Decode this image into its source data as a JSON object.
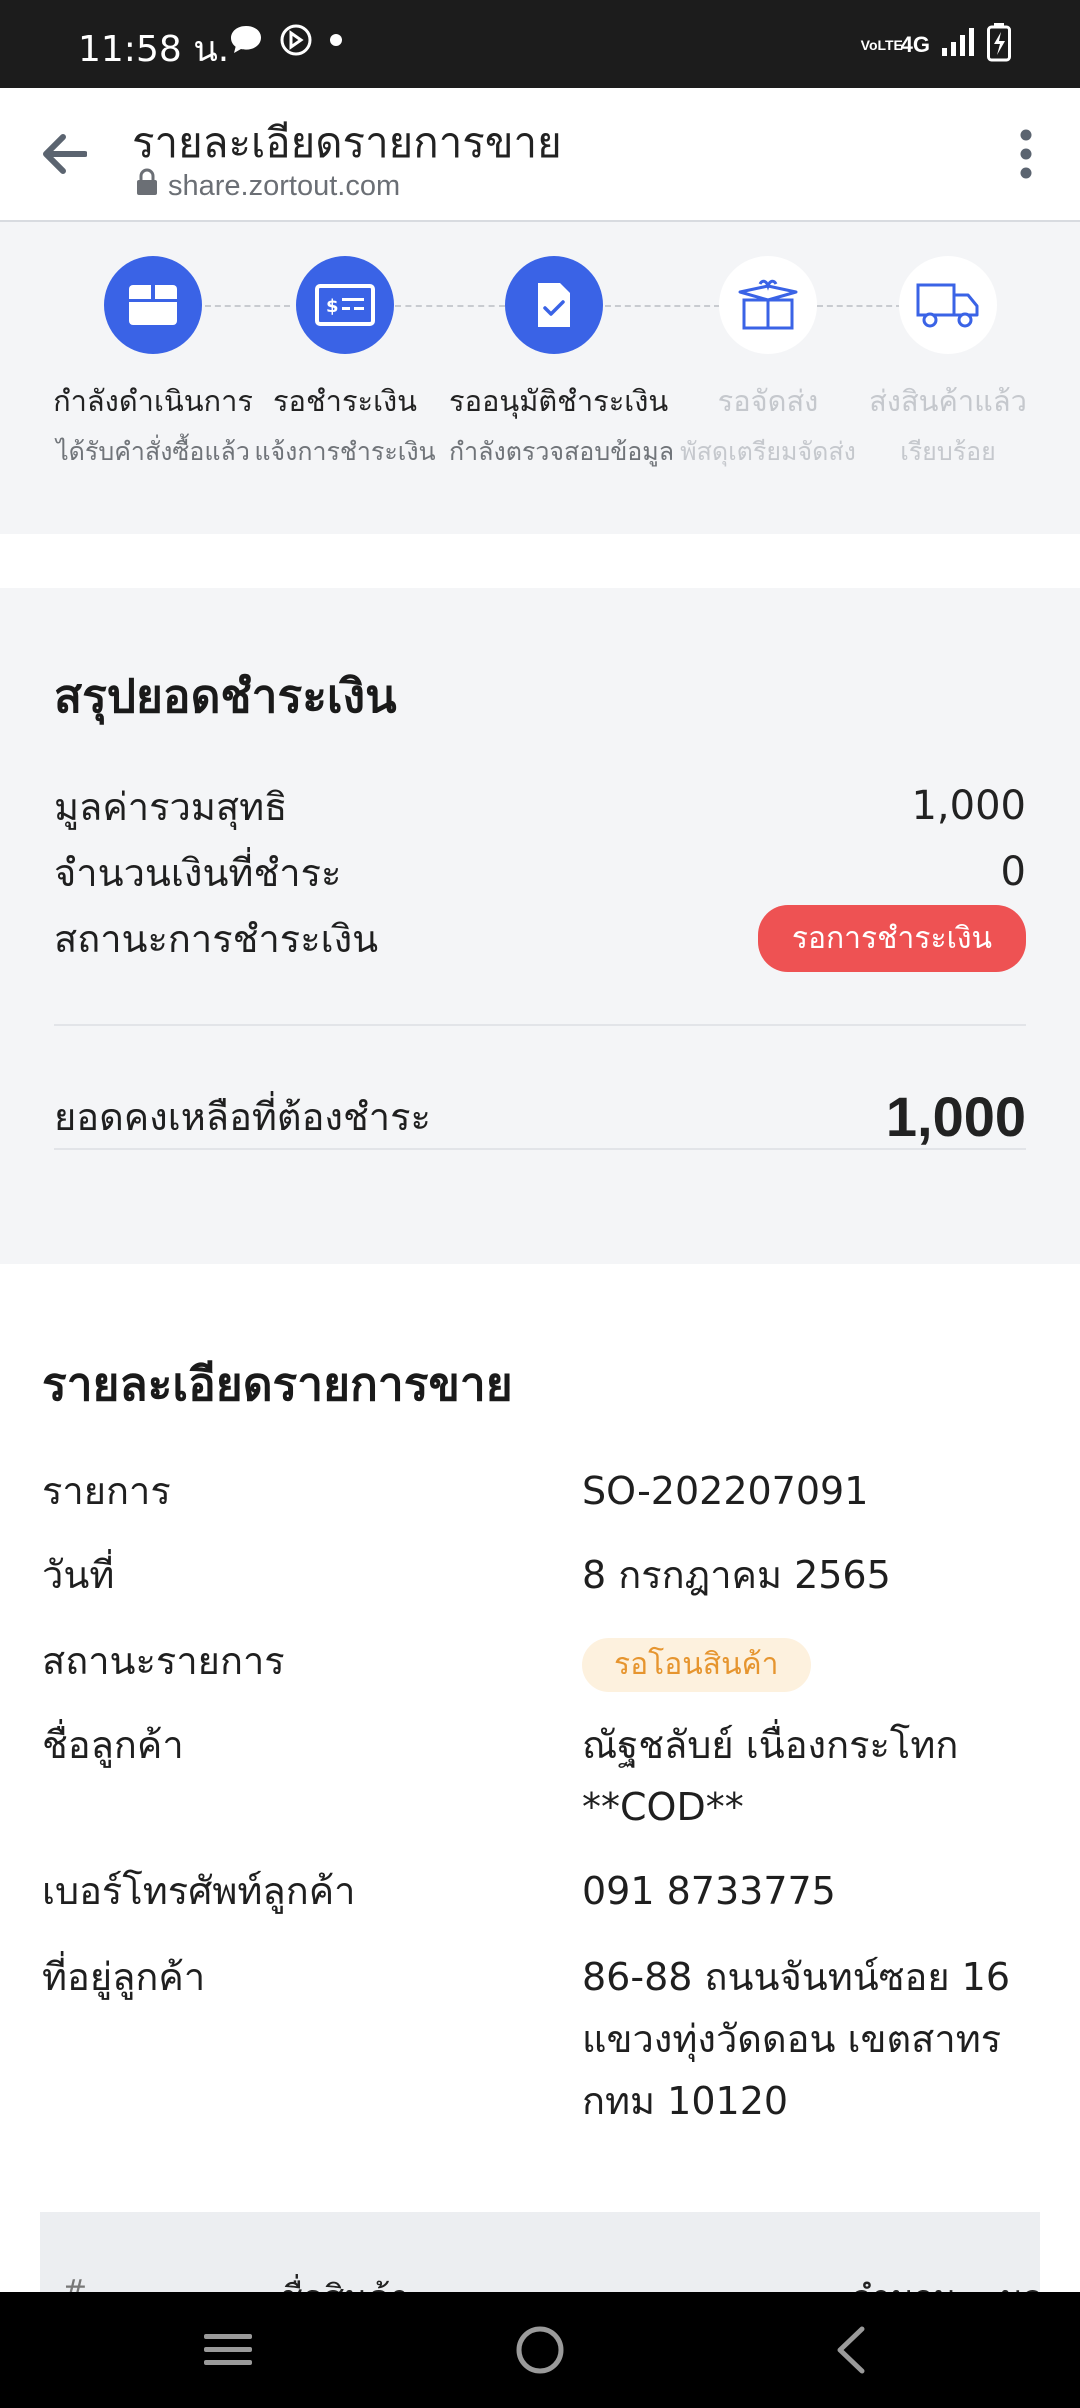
{
  "status_bar": {
    "time": "11:58 น.",
    "network": "4G",
    "volte": "VoLTE"
  },
  "browser": {
    "title": "รายละเอียดรายการขาย",
    "url": "share.zortout.com"
  },
  "steps": [
    {
      "label": "กำลังดำเนินการ",
      "sub": "ได้รับคำสั่งซื้อแล้ว",
      "icon": "box-icon",
      "state": "active"
    },
    {
      "label": "รอชำระเงิน",
      "sub": "แจ้งการชำระเงิน",
      "icon": "payment-card-icon",
      "state": "active"
    },
    {
      "label": "รออนุมัติชำระเงิน",
      "sub": "กำลังตรวจสอบข้อมูล",
      "icon": "document-check-icon",
      "state": "active"
    },
    {
      "label": "รอจัดส่ง",
      "sub": "พัสดุเตรียมจัดส่ง",
      "icon": "gift-box-icon",
      "state": "inactive"
    },
    {
      "label": "ส่งสินค้าแล้ว",
      "sub": "เรียบร้อย",
      "icon": "truck-icon",
      "state": "inactive"
    }
  ],
  "summary": {
    "title": "สรุปยอดชำระเงิน",
    "net_total_label": "มูลค่ารวมสุทธิ",
    "net_total_value": "1,000",
    "paid_label": "จำนวนเงินที่ชำระ",
    "paid_value": "0",
    "payment_status_label": "สถานะการชำระเงิน",
    "payment_status_value": "รอการชำระเงิน",
    "balance_label": "ยอดคงเหลือที่ต้องชำระ",
    "balance_value": "1,000",
    "colors": {
      "payment_badge": "#ee5253",
      "accent": "#3a63e6"
    }
  },
  "details": {
    "title": "รายละเอียดรายการขาย",
    "order_label": "รายการ",
    "order_value": "SO-202207091",
    "date_label": "วันที่",
    "date_value": "8 กรกฎาคม 2565",
    "status_label": "สถานะรายการ",
    "status_value": "รอโอนสินค้า",
    "customer_label": "ชื่อลูกค้า",
    "customer_value_line1": "ณัฐชลับย์ เนื่องกระโทก",
    "customer_value_line2": "**COD**",
    "phone_label": "เบอร์โทรศัพท์ลูกค้า",
    "phone_value": "091 8733775",
    "address_label": "ที่อยู่ลูกค้า",
    "address_line1": "86-88 ถนนจันทน์ซอย 16",
    "address_line2": "แขวงทุ่งวัดดอน เขตสาทร",
    "address_line3": "กทม 10120"
  },
  "items_table": {
    "headers": [
      "#",
      "ชื่อสินค้า",
      "จำนวน",
      "มูลค่า"
    ]
  }
}
